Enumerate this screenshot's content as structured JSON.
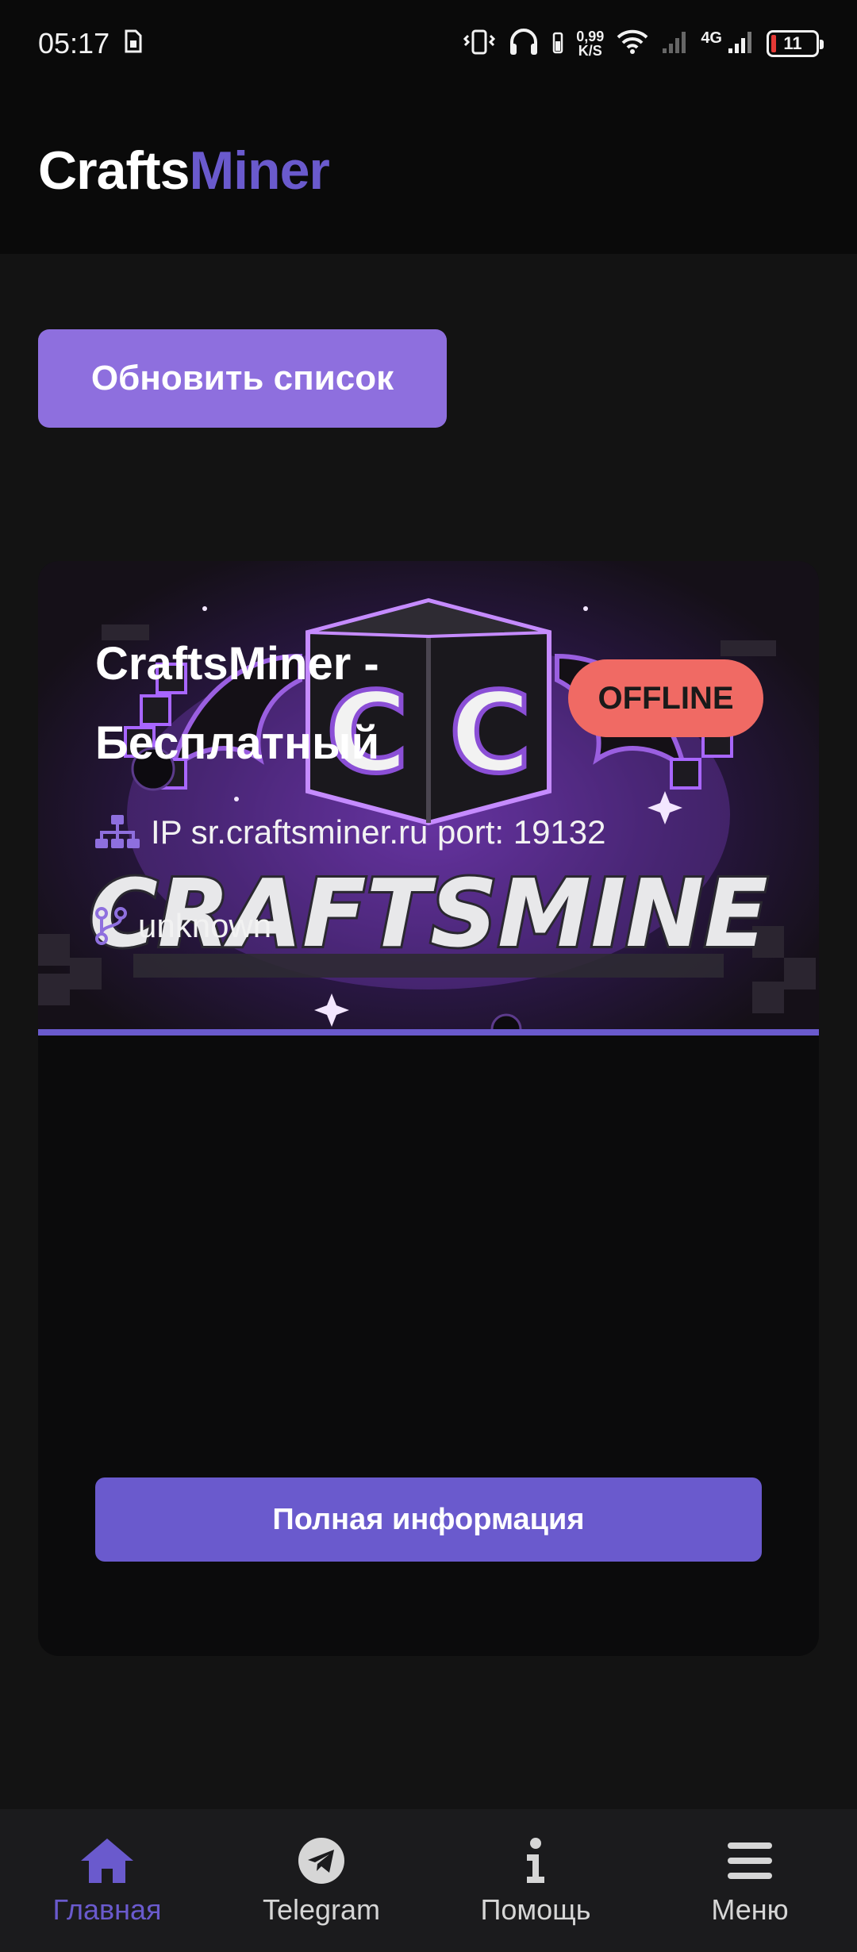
{
  "status_bar": {
    "time": "05:17",
    "net_speed_value": "0,99",
    "net_speed_unit": "K/S",
    "network_type": "4G",
    "battery": "11",
    "battery_color": "#e53935"
  },
  "header": {
    "brand_part1": "Crafts",
    "brand_part2": "Miner",
    "accent_color": "#6a5acd"
  },
  "refresh_button": {
    "label": "Обновить список"
  },
  "server": {
    "banner_text": "CRAFTSMINE",
    "banner_letters": "C C",
    "title_line1": "CraftsMiner -",
    "title_line2": "Бесплатный",
    "status": "OFFLINE",
    "status_color": "#f06a64",
    "ip_text": "IP sr.craftsminer.ru port: 19132",
    "version": "unknown",
    "details_button": "Полная информация"
  },
  "bottom_nav": {
    "items": [
      {
        "label": "Главная",
        "icon": "home-icon",
        "active": true
      },
      {
        "label": "Telegram",
        "icon": "telegram-icon",
        "active": false
      },
      {
        "label": "Помощь",
        "icon": "info-icon",
        "active": false
      },
      {
        "label": "Меню",
        "icon": "menu-icon",
        "active": false
      }
    ]
  }
}
